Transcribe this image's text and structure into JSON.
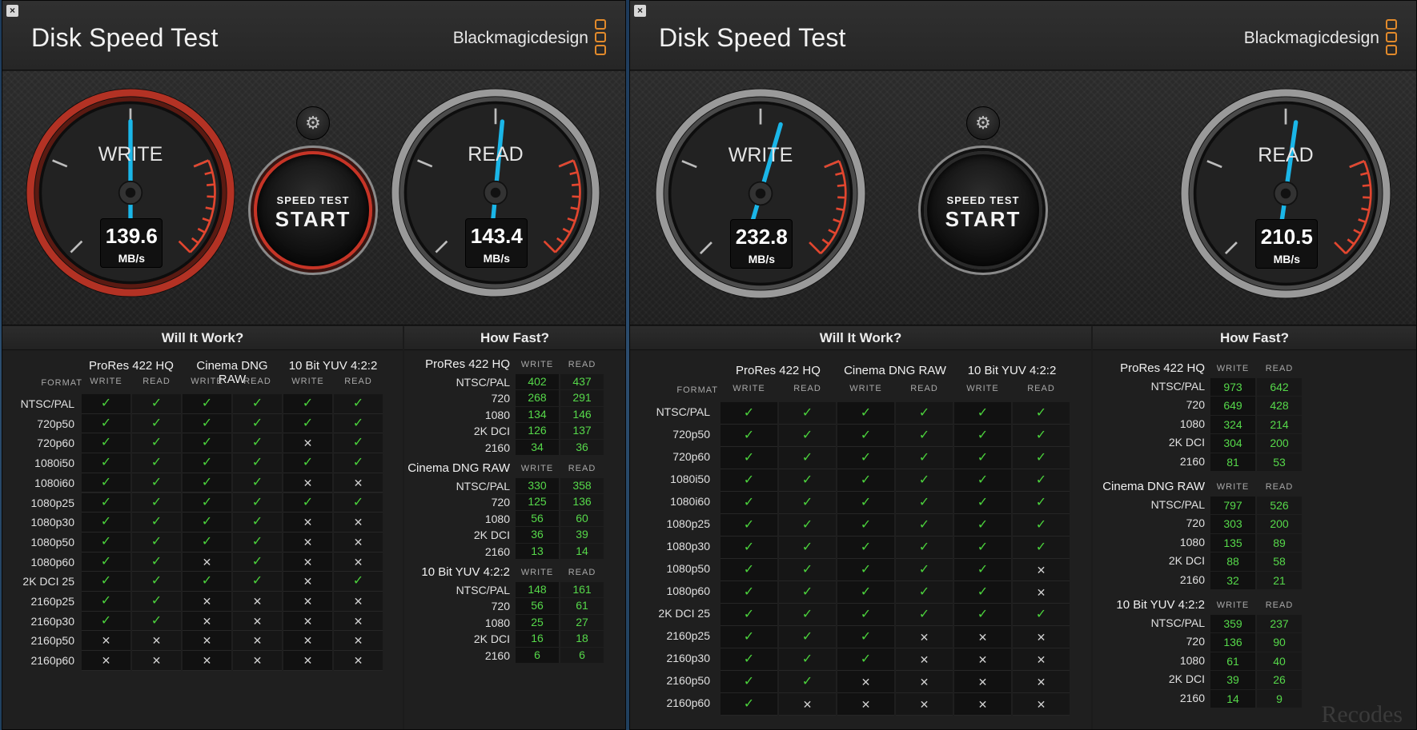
{
  "watermark": "Recodes",
  "windows": [
    {
      "close_label": "×",
      "title": "Disk Speed Test",
      "brand": "Blackmagicdesign",
      "write": {
        "label": "WRITE",
        "value": "139.6",
        "unit": "MB/s",
        "fraction": 0.5
      },
      "read": {
        "label": "READ",
        "value": "143.4",
        "unit": "MB/s",
        "fraction": 0.52
      },
      "gear_icon": "⚙",
      "start": {
        "small": "SPEED TEST",
        "big": "START"
      },
      "will": {
        "title": "Will It Work?",
        "format_label": "FORMAT",
        "groups": [
          "ProRes 422 HQ",
          "Cinema DNG RAW",
          "10 Bit YUV 4:2:2"
        ],
        "col_write": "WRITE",
        "col_read": "READ",
        "rows": [
          {
            "label": "NTSC/PAL",
            "v": [
              1,
              1,
              1,
              1,
              1,
              1
            ]
          },
          {
            "label": "720p50",
            "v": [
              1,
              1,
              1,
              1,
              1,
              1
            ]
          },
          {
            "label": "720p60",
            "v": [
              1,
              1,
              1,
              1,
              0,
              1
            ]
          },
          {
            "label": "1080i50",
            "v": [
              1,
              1,
              1,
              1,
              1,
              1
            ]
          },
          {
            "label": "1080i60",
            "v": [
              1,
              1,
              1,
              1,
              0,
              0
            ]
          },
          {
            "label": "1080p25",
            "v": [
              1,
              1,
              1,
              1,
              1,
              1
            ]
          },
          {
            "label": "1080p30",
            "v": [
              1,
              1,
              1,
              1,
              0,
              0
            ]
          },
          {
            "label": "1080p50",
            "v": [
              1,
              1,
              1,
              1,
              0,
              0
            ]
          },
          {
            "label": "1080p60",
            "v": [
              1,
              1,
              0,
              1,
              0,
              0
            ]
          },
          {
            "label": "2K DCI 25",
            "v": [
              1,
              1,
              1,
              1,
              0,
              1
            ]
          },
          {
            "label": "2160p25",
            "v": [
              1,
              1,
              0,
              0,
              0,
              0
            ]
          },
          {
            "label": "2160p30",
            "v": [
              1,
              1,
              0,
              0,
              0,
              0
            ]
          },
          {
            "label": "2160p50",
            "v": [
              0,
              0,
              0,
              0,
              0,
              0
            ]
          },
          {
            "label": "2160p60",
            "v": [
              0,
              0,
              0,
              0,
              0,
              0
            ]
          }
        ]
      },
      "fast": {
        "title": "How Fast?",
        "col_write": "WRITE",
        "col_read": "READ",
        "groups": [
          {
            "name": "ProRes 422 HQ",
            "rows": [
              {
                "label": "NTSC/PAL",
                "w": "402",
                "r": "437"
              },
              {
                "label": "720",
                "w": "268",
                "r": "291"
              },
              {
                "label": "1080",
                "w": "134",
                "r": "146"
              },
              {
                "label": "2K DCI",
                "w": "126",
                "r": "137"
              },
              {
                "label": "2160",
                "w": "34",
                "r": "36"
              }
            ]
          },
          {
            "name": "Cinema DNG RAW",
            "rows": [
              {
                "label": "NTSC/PAL",
                "w": "330",
                "r": "358"
              },
              {
                "label": "720",
                "w": "125",
                "r": "136"
              },
              {
                "label": "1080",
                "w": "56",
                "r": "60"
              },
              {
                "label": "2K DCI",
                "w": "36",
                "r": "39"
              },
              {
                "label": "2160",
                "w": "13",
                "r": "14"
              }
            ]
          },
          {
            "name": "10 Bit YUV 4:2:2",
            "rows": [
              {
                "label": "NTSC/PAL",
                "w": "148",
                "r": "161"
              },
              {
                "label": "720",
                "w": "56",
                "r": "61"
              },
              {
                "label": "1080",
                "w": "25",
                "r": "27"
              },
              {
                "label": "2K DCI",
                "w": "16",
                "r": "18"
              },
              {
                "label": "2160",
                "w": "6",
                "r": "6"
              }
            ]
          }
        ]
      }
    },
    {
      "close_label": "×",
      "title": "Disk Speed Test",
      "brand": "Blackmagicdesign",
      "write": {
        "label": "WRITE",
        "value": "232.8",
        "unit": "MB/s",
        "fraction": 0.56
      },
      "read": {
        "label": "READ",
        "value": "210.5",
        "unit": "MB/s",
        "fraction": 0.53
      },
      "gear_icon": "⚙",
      "start": {
        "small": "SPEED TEST",
        "big": "START"
      },
      "will": {
        "title": "Will It Work?",
        "format_label": "FORMAT",
        "groups": [
          "ProRes 422 HQ",
          "Cinema DNG RAW",
          "10 Bit YUV 4:2:2"
        ],
        "col_write": "WRITE",
        "col_read": "READ",
        "rows": [
          {
            "label": "NTSC/PAL",
            "v": [
              1,
              1,
              1,
              1,
              1,
              1
            ]
          },
          {
            "label": "720p50",
            "v": [
              1,
              1,
              1,
              1,
              1,
              1
            ]
          },
          {
            "label": "720p60",
            "v": [
              1,
              1,
              1,
              1,
              1,
              1
            ]
          },
          {
            "label": "1080i50",
            "v": [
              1,
              1,
              1,
              1,
              1,
              1
            ]
          },
          {
            "label": "1080i60",
            "v": [
              1,
              1,
              1,
              1,
              1,
              1
            ]
          },
          {
            "label": "1080p25",
            "v": [
              1,
              1,
              1,
              1,
              1,
              1
            ]
          },
          {
            "label": "1080p30",
            "v": [
              1,
              1,
              1,
              1,
              1,
              1
            ]
          },
          {
            "label": "1080p50",
            "v": [
              1,
              1,
              1,
              1,
              1,
              0
            ]
          },
          {
            "label": "1080p60",
            "v": [
              1,
              1,
              1,
              1,
              1,
              0
            ]
          },
          {
            "label": "2K DCI 25",
            "v": [
              1,
              1,
              1,
              1,
              1,
              1
            ]
          },
          {
            "label": "2160p25",
            "v": [
              1,
              1,
              1,
              0,
              0,
              0
            ]
          },
          {
            "label": "2160p30",
            "v": [
              1,
              1,
              1,
              0,
              0,
              0
            ]
          },
          {
            "label": "2160p50",
            "v": [
              1,
              1,
              0,
              0,
              0,
              0
            ]
          },
          {
            "label": "2160p60",
            "v": [
              1,
              0,
              0,
              0,
              0,
              0
            ]
          }
        ]
      },
      "fast": {
        "title": "How Fast?",
        "col_write": "WRITE",
        "col_read": "READ",
        "groups": [
          {
            "name": "ProRes 422 HQ",
            "rows": [
              {
                "label": "NTSC/PAL",
                "w": "973",
                "r": "642"
              },
              {
                "label": "720",
                "w": "649",
                "r": "428"
              },
              {
                "label": "1080",
                "w": "324",
                "r": "214"
              },
              {
                "label": "2K DCI",
                "w": "304",
                "r": "200"
              },
              {
                "label": "2160",
                "w": "81",
                "r": "53"
              }
            ]
          },
          {
            "name": "Cinema DNG RAW",
            "rows": [
              {
                "label": "NTSC/PAL",
                "w": "797",
                "r": "526"
              },
              {
                "label": "720",
                "w": "303",
                "r": "200"
              },
              {
                "label": "1080",
                "w": "135",
                "r": "89"
              },
              {
                "label": "2K DCI",
                "w": "88",
                "r": "58"
              },
              {
                "label": "2160",
                "w": "32",
                "r": "21"
              }
            ]
          },
          {
            "name": "10 Bit YUV 4:2:2",
            "rows": [
              {
                "label": "NTSC/PAL",
                "w": "359",
                "r": "237"
              },
              {
                "label": "720",
                "w": "136",
                "r": "90"
              },
              {
                "label": "1080",
                "w": "61",
                "r": "40"
              },
              {
                "label": "2K DCI",
                "w": "39",
                "r": "26"
              },
              {
                "label": "2160",
                "w": "14",
                "r": "9"
              }
            ]
          }
        ]
      }
    }
  ]
}
